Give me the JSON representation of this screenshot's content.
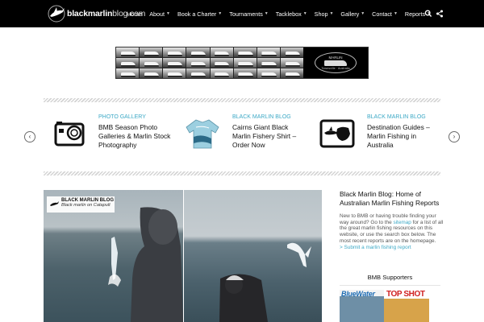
{
  "brand": {
    "name_bold": "blackmarlin",
    "name_thin": "blog.com"
  },
  "nav": {
    "items": [
      {
        "label": "Home",
        "has_menu": false
      },
      {
        "label": "About",
        "has_menu": true
      },
      {
        "label": "Book a Charter",
        "has_menu": true
      },
      {
        "label": "Tournaments",
        "has_menu": true
      },
      {
        "label": "Tacklebox",
        "has_menu": true
      },
      {
        "label": "Shop",
        "has_menu": true
      },
      {
        "label": "Gallery",
        "has_menu": true
      },
      {
        "label": "Contact",
        "has_menu": true
      },
      {
        "label": "Reports",
        "has_menu": true
      }
    ],
    "icons": [
      "search-icon",
      "share-icon"
    ]
  },
  "banner": {
    "badge_top": "MARLIN",
    "badge_bottom": "Townsville · Australia"
  },
  "carousel": {
    "prev_icon": "chevron-left-icon",
    "next_icon": "chevron-right-icon",
    "cards": [
      {
        "category": "PHOTO GALLERY",
        "title": "BMB Season Photo Galleries & Marlin Stock Photography",
        "icon": "action-camera-icon"
      },
      {
        "category": "BLACK MARLIN BLOG",
        "title": "Cairns Giant Black Marlin Fishery Shirt – Order Now",
        "icon": "fishing-shirt-icon"
      },
      {
        "category": "BLACK MARLIN BLOG",
        "title": "Destination Guides – Marlin Fishing in Australia",
        "icon": "marlin-australia-map-icon"
      }
    ]
  },
  "feature": {
    "label_title": "BLACK MARLIN BLOG",
    "label_subtitle": "Black marlin on Catapult"
  },
  "sidebar": {
    "title": "Black Marlin Blog: Home of Australian Marlin Fishing Reports",
    "intro_before": "New to BMB or having trouble finding your way around? Go to the ",
    "intro_link": "sitemap",
    "intro_after": " for a list of all the great marlin fishing resources on this website, or use the search box below. The most recent reports are on the homepage.",
    "submit_link": "> Submit a marlin fishing report",
    "supporters_heading": "BMB Supporters",
    "magazines": [
      "BlueWater",
      "TOP SHOT"
    ]
  },
  "colors": {
    "accent": "#3da9c6",
    "topbar": "#000000"
  }
}
